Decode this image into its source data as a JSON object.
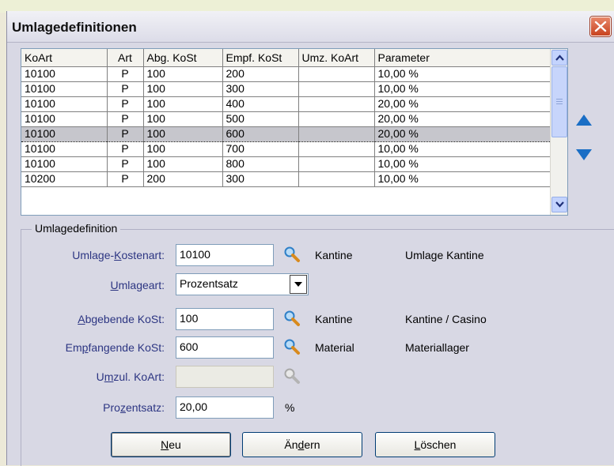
{
  "window": {
    "title": "Umlagedefinitionen"
  },
  "grid": {
    "columns": [
      "KoArt",
      "Art",
      "Abg. KoSt",
      "Empf. KoSt",
      "Umz. KoArt",
      "Parameter"
    ],
    "rows": [
      [
        "10100",
        "P",
        "100",
        "200",
        "",
        "10,00 %"
      ],
      [
        "10100",
        "P",
        "100",
        "300",
        "",
        "10,00 %"
      ],
      [
        "10100",
        "P",
        "100",
        "400",
        "",
        "20,00 %"
      ],
      [
        "10100",
        "P",
        "100",
        "500",
        "",
        "20,00 %"
      ],
      [
        "10100",
        "P",
        "100",
        "600",
        "",
        "20,00 %"
      ],
      [
        "10100",
        "P",
        "100",
        "700",
        "",
        "10,00 %"
      ],
      [
        "10100",
        "P",
        "100",
        "800",
        "",
        "10,00 %"
      ],
      [
        "10200",
        "P",
        "200",
        "300",
        "",
        "10,00 %"
      ]
    ],
    "selected_row": 4
  },
  "form": {
    "legend": "Umlagedefinition",
    "kostenart": {
      "label_pre": "Umlage-",
      "label_ul": "K",
      "label_post": "ostenart:",
      "value": "10100",
      "name": "Kantine",
      "desc": "Umlage Kantine"
    },
    "umlageart": {
      "label_ul": "U",
      "label_post": "mlageart:",
      "value": "Prozentsatz"
    },
    "abgebende": {
      "label_ul": "A",
      "label_post": "bgebende KoSt:",
      "value": "100",
      "name": "Kantine",
      "desc": "Kantine / Casino"
    },
    "empfangende": {
      "label_pre": "Em",
      "label_ul": "p",
      "label_post": "fangende KoSt:",
      "value": "600",
      "name": "Material",
      "desc": "Materiallager"
    },
    "umzul": {
      "label_pre": "U",
      "label_ul": "m",
      "label_post": "zul. KoArt:",
      "value": ""
    },
    "prozentsatz": {
      "label_pre": "Pro",
      "label_ul": "z",
      "label_post": "entsatz:",
      "value": "20,00",
      "unit": "%"
    }
  },
  "buttons": {
    "new": {
      "ul": "N",
      "rest": "eu"
    },
    "edit": {
      "pre": "Än",
      "ul": "d",
      "rest": "ern"
    },
    "delete": {
      "ul": "L",
      "rest": "öschen"
    }
  }
}
